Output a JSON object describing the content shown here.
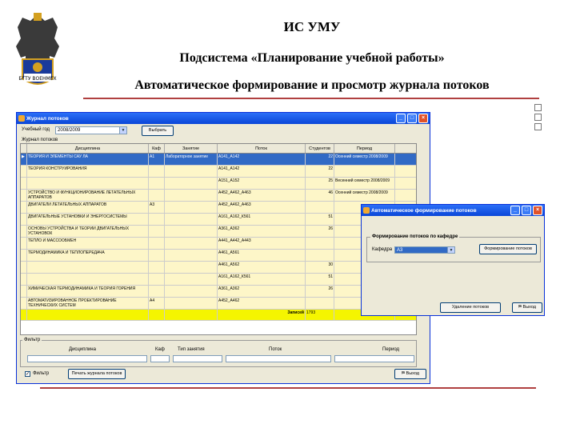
{
  "slide": {
    "title": "ИС УМУ",
    "subtitle": "Подсистема «Планирование учебной работы»",
    "heading": "Автоматическое формирование и просмотр журнала потоков",
    "emblem_text": "БГТУ ВОЕНМЕХ"
  },
  "main_window": {
    "title": "Журнал потоков",
    "year_label": "Учебный год",
    "year_value": "2008/2009",
    "select_button": "Выбрать",
    "journal_label": "Журнал потоков",
    "columns": [
      "Дисциплина",
      "Каф",
      "Занятие",
      "Поток",
      "Студентов",
      "Период"
    ],
    "rows": [
      {
        "disc": "ТЕОРИЯ И ЭЛЕМЕНТЫ САУ ЛА",
        "kaf": "А1",
        "zan": "Лабораторное занятие",
        "potok": "А141_А142",
        "stud": "22",
        "period": "Осенний семестр 2008/2009"
      },
      {
        "disc": "ТЕОРИЯ КОНСТРУИРОВАНИЯ",
        "kaf": "",
        "zan": "",
        "potok": "А141_А142",
        "stud": "22",
        "period": ""
      },
      {
        "disc": "",
        "kaf": "",
        "zan": "",
        "potok": "А151_А152",
        "stud": "25",
        "period": "Весенний семестр 2008/2009"
      },
      {
        "disc": "УСТРОЙСТВО И ФУНКЦИОНИРОВАНИЕ ЛЕТАТЕЛЬНЫХ АППАРАТОВ",
        "kaf": "",
        "zan": "",
        "potok": "А452_А462_А463",
        "stud": "46",
        "period": "Осенний семестр 2008/2009"
      },
      {
        "disc": "ДВИГАТЕЛИ ЛЕТАТЕЛЬНЫХ АППАРАТОВ",
        "kaf": "А3",
        "zan": "",
        "potok": "А452_А462_А463",
        "stud": "",
        "period": ""
      },
      {
        "disc": "ДВИГАТЕЛЬНЫЕ УСТАНОВКИ И ЭНЕРГОСИСТЕМЫ",
        "kaf": "",
        "zan": "",
        "potok": "А161_А162_К561",
        "stud": "51",
        "period": ""
      },
      {
        "disc": "ОСНОВЫ УСТРОЙСТВА И ТЕОРИИ ДВИГАТЕЛЬНЫХ УСТАНОВОК",
        "kaf": "",
        "zan": "",
        "potok": "А361_А362",
        "stud": "26",
        "period": ""
      },
      {
        "disc": "ТЕПЛО И МАССООБМЕН",
        "kaf": "",
        "zan": "",
        "potok": "А441_А442_А443",
        "stud": "",
        "period": ""
      },
      {
        "disc": "ТЕРМОДИНАМИКА И ТЕПЛОПЕРЕДАЧА",
        "kaf": "",
        "zan": "",
        "potok": "А461_А561",
        "stud": "",
        "period": ""
      },
      {
        "disc": "",
        "kaf": "",
        "zan": "",
        "potok": "А461_А562",
        "stud": "30",
        "period": ""
      },
      {
        "disc": "",
        "kaf": "",
        "zan": "",
        "potok": "А161_А162_К561",
        "stud": "51",
        "period": ""
      },
      {
        "disc": "ХИМИЧЕСКАЯ ТЕРМОДИНАМИКА И ТЕОРИЯ ГОРЕНИЯ",
        "kaf": "",
        "zan": "",
        "potok": "А361_А362",
        "stud": "26",
        "period": ""
      },
      {
        "disc": "АВТОМАТИЗИРОВАННОЕ ПРОЕКТИРОВАНИЕ ТЕХНИЧЕСКИХ СИСТЕМ",
        "kaf": "А4",
        "zan": "",
        "potok": "А452_А462",
        "stud": "",
        "period": ""
      }
    ],
    "total_label": "Записей",
    "total_value": "1793",
    "filter_label": "Фильтр",
    "filter_columns": [
      "Дисциплина",
      "Каф",
      "Тип занятия",
      "Поток",
      "Период"
    ],
    "filter_checkbox": "Фильтр",
    "print_button": "Печать журнала потоков",
    "exit_button": "Выход"
  },
  "popup": {
    "title": "Автоматическое формирование потоков",
    "group_label": "Формирование потоков по кафедре",
    "kafedra_label": "Кафедра",
    "kafedra_value": "А3",
    "form_button": "Формирование потоков",
    "delete_button": "Удаление потоков",
    "exit_button": "Выход"
  }
}
